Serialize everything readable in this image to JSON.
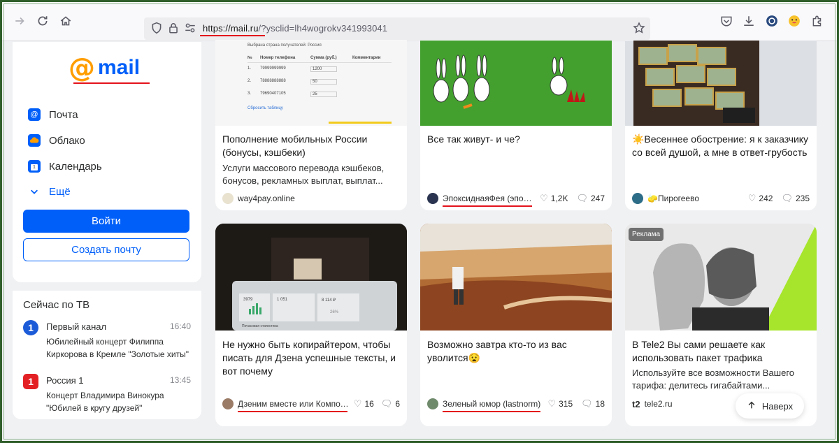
{
  "browser": {
    "url_host": "https://mail.ru",
    "url_rest": "/?ysclid=lh4wogrokv341993041"
  },
  "logo": {
    "at": "@",
    "text": "mail"
  },
  "nav": [
    {
      "label": "Почта",
      "icon": "mail-icon",
      "color": "#005ff9"
    },
    {
      "label": "Облако",
      "icon": "cloud-icon",
      "color": "#005ff9"
    },
    {
      "label": "Календарь",
      "icon": "calendar-icon",
      "color": "#005ff9"
    },
    {
      "label": "Ещё",
      "icon": "chevron-down-icon"
    }
  ],
  "auth": {
    "login_label": "Войти",
    "create_label": "Создать почту"
  },
  "tv": {
    "title": "Сейчас по ТВ",
    "items": [
      {
        "channel": "Первый канал",
        "logo_text": "1",
        "time": "16:40",
        "show": "Юбилейный концерт Филиппа Киркорова в Кремле \"Золотые хиты\""
      },
      {
        "channel": "Россия 1",
        "logo_text": "1",
        "time": "13:45",
        "show": "Концерт Владимира Винокура \"Юбилей в кругу друзей\""
      }
    ]
  },
  "cards": [
    {
      "title": "Пополнение мобильных России (бонусы, кэшбеки)",
      "desc": "Услуги массового перевода кэшбеков, бонусов, рекламных выплат, выплат...",
      "source": "way4pay.online",
      "likes": "",
      "comments": ""
    },
    {
      "title": "Все так живут- и че?",
      "desc": "",
      "source": "ЭпоксиднаяФея (эпок...",
      "likes": "1,2K",
      "comments": "247"
    },
    {
      "title": "☀️Весеннее обострение: я к заказчику со всей душой, а мне в ответ-грубость",
      "desc": "",
      "source": "🧽Пирогеево",
      "likes": "242",
      "comments": "235"
    },
    {
      "title": "Не нужно быть копирайтером, чтобы писать для Дзена успешные тексты, и вот почему",
      "desc": "",
      "source": "Дзеним вместе или Компот...",
      "likes": "16",
      "comments": "6"
    },
    {
      "title": "Возможно завтра кто-то из вас уволится😧",
      "desc": "",
      "source": "Зеленый юмор (lastnorm)",
      "likes": "315",
      "comments": "18"
    },
    {
      "title": "В Tele2 Вы сами решаете как использовать пакет трафика",
      "desc": "Используйте все возможности Вашего тарифа: делитесь гигабайтами...",
      "source": "tele2.ru",
      "likes": "",
      "comments": "",
      "badge": "Реклама"
    }
  ],
  "screenshot_table": {
    "caption": "Выбрана страна получателей: Россия",
    "headers": [
      "№",
      "Номер телефона",
      "Сумма (руб.)",
      "Комментарии"
    ],
    "rows": [
      [
        "1.",
        "79999999999",
        "1200"
      ],
      [
        "2.",
        "78888888888",
        "50"
      ],
      [
        "3.",
        "79690407105",
        "25"
      ]
    ],
    "reset": "Сбросить таблицу"
  },
  "dash_numbers": {
    "a": "3979",
    "b": "1 051",
    "c": "8 114 ₽",
    "d": "26%",
    "e": "Почасовая статистика"
  },
  "scroll_up_label": "Наверх",
  "colors": {
    "brand_blue": "#005ff9",
    "brand_orange": "#ff9e00",
    "annotation_red": "#e3121b"
  }
}
